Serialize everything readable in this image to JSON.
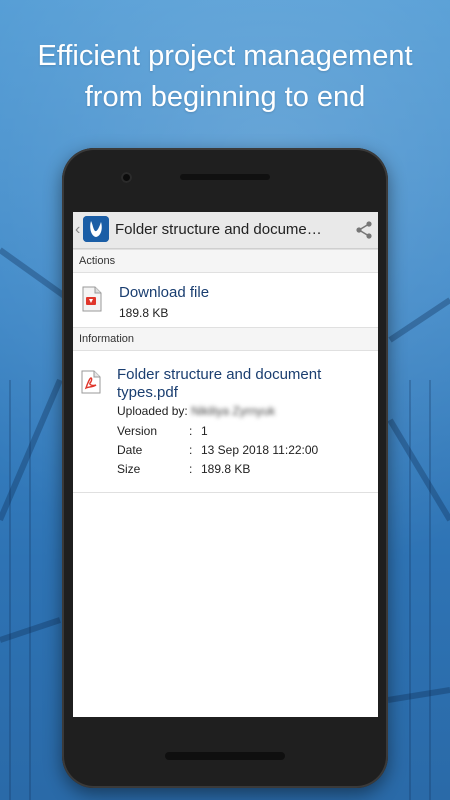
{
  "headline": {
    "line1": "Efficient project management",
    "line2": "from beginning to end"
  },
  "app": {
    "title": "Folder structure and docume…",
    "icons": {
      "back": "chevron-left-icon",
      "logo": "app-logo-icon",
      "share": "share-icon"
    }
  },
  "actions": {
    "header": "Actions",
    "download_label": "Download file",
    "download_size": "189.8 KB"
  },
  "information": {
    "header": "Information",
    "file_title": "Folder structure and document types.pdf",
    "uploaded_by_label": "Uploaded by:",
    "uploaded_by_value": "Nikiliya Zyrnyuk",
    "version_label": "Version",
    "version_value": "1",
    "date_label": "Date",
    "date_value": "13 Sep 2018 11:22:00",
    "size_label": "Size",
    "size_value": "189.8 KB",
    "separator": ":"
  },
  "colors": {
    "accent_link": "#1a3e70",
    "app_logo": "#1b5ea6",
    "pdf_red": "#e0362b"
  }
}
